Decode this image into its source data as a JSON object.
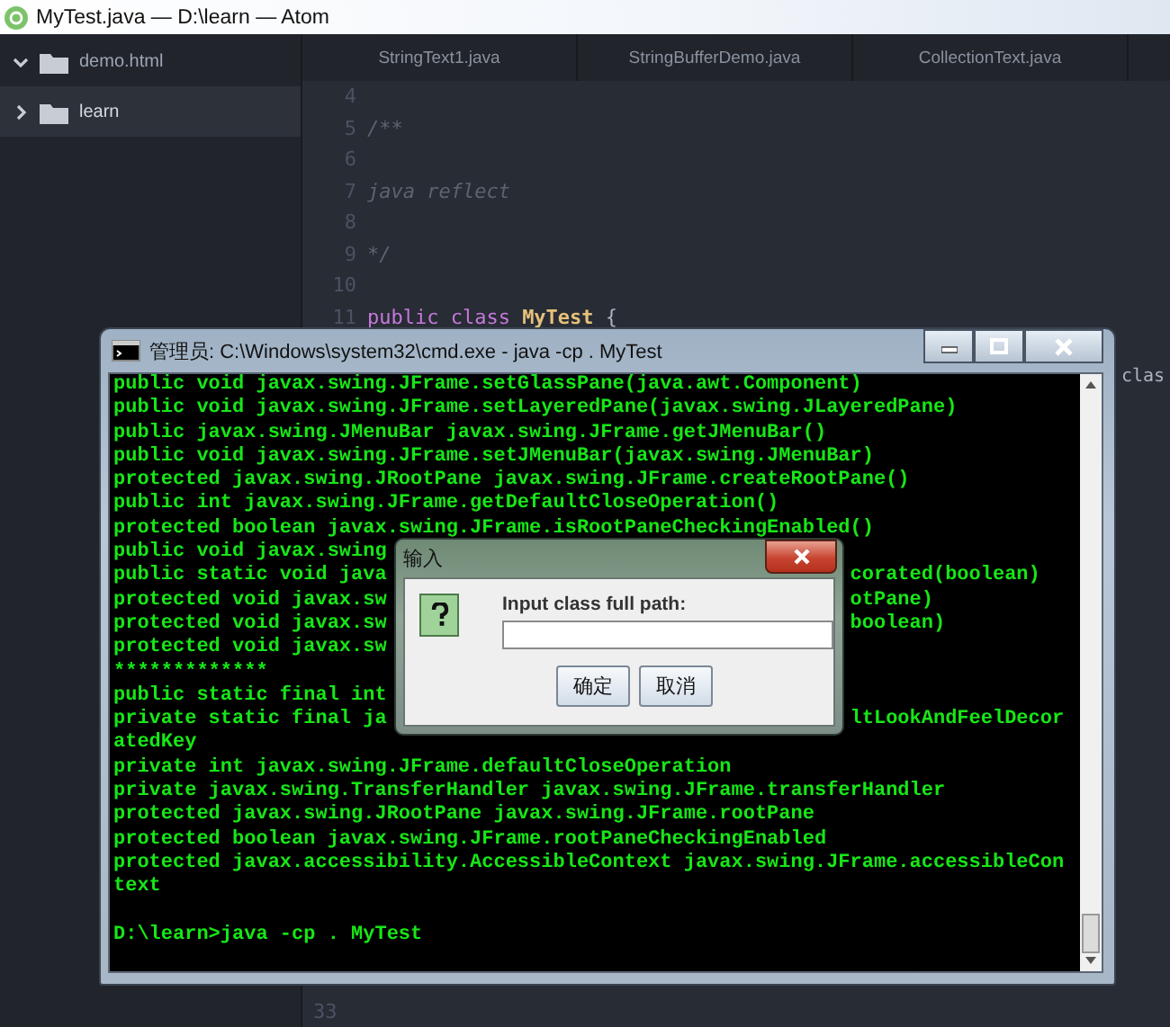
{
  "window": {
    "title": "MyTest.java — D:\\learn — Atom"
  },
  "tree": [
    {
      "label": "demo.html",
      "expanded": true,
      "selected": false
    },
    {
      "label": "learn",
      "expanded": false,
      "selected": true
    }
  ],
  "tabs": [
    {
      "label": "StringText1.java"
    },
    {
      "label": "StringBufferDemo.java"
    },
    {
      "label": "CollectionText.java"
    }
  ],
  "editor": {
    "lines": [
      {
        "number": "4"
      },
      {
        "number": "5",
        "tokens": [
          {
            "text": "/**",
            "kind": "comment"
          }
        ]
      },
      {
        "number": "6"
      },
      {
        "number": "7",
        "tokens": [
          {
            "text": "java reflect",
            "kind": "comment"
          }
        ]
      },
      {
        "number": "8"
      },
      {
        "number": "9",
        "tokens": [
          {
            "text": "*/",
            "kind": "comment"
          }
        ]
      },
      {
        "number": "10"
      },
      {
        "number": "11",
        "tokens": [
          {
            "text": "public",
            "kind": "keyword"
          },
          {
            "text": "class",
            "kind": "keyword"
          },
          {
            "text": "MyTest",
            "kind": "type"
          },
          {
            "text": "{",
            "kind": "plain"
          }
        ]
      }
    ],
    "peek_text": "clas",
    "bottom_line_number": "33"
  },
  "console": {
    "title": "管理员: C:\\Windows\\system32\\cmd.exe - java  -cp . MyTest",
    "lines": [
      {
        "kind": "text",
        "text": "public void javax.swing.JFrame.setGlassPane(java.awt.Component)"
      },
      {
        "kind": "text",
        "text": "public void javax.swing.JFrame.setLayeredPane(javax.swing.JLayeredPane)"
      },
      {
        "kind": "text",
        "text": "public javax.swing.JMenuBar javax.swing.JFrame.getJMenuBar()"
      },
      {
        "kind": "text",
        "text": "public void javax.swing.JFrame.setJMenuBar(javax.swing.JMenuBar)"
      },
      {
        "kind": "text",
        "text": "protected javax.swing.JRootPane javax.swing.JFrame.createRootPane()"
      },
      {
        "kind": "text",
        "text": "public int javax.swing.JFrame.getDefaultCloseOperation()"
      },
      {
        "kind": "text",
        "text": "protected boolean javax.swing.JFrame.isRootPaneCheckingEnabled()"
      },
      {
        "kind": "text",
        "text": "public void javax.swing"
      },
      {
        "kind": "split",
        "text": "public static void java",
        "right": "corated(boolean)"
      },
      {
        "kind": "split",
        "text": "protected void javax.sw",
        "right": "otPane)"
      },
      {
        "kind": "split",
        "text": "protected void javax.sw",
        "right": "boolean)"
      },
      {
        "kind": "text",
        "text": "protected void javax.sw"
      },
      {
        "kind": "text",
        "text": "*************"
      },
      {
        "kind": "text",
        "text": "public static final int"
      },
      {
        "kind": "split",
        "text": "private static final ja",
        "right": "ltLookAndFeelDecor"
      },
      {
        "kind": "text",
        "text": "atedKey"
      },
      {
        "kind": "text",
        "text": "private int javax.swing.JFrame.defaultCloseOperation"
      },
      {
        "kind": "text",
        "text": "private javax.swing.TransferHandler javax.swing.JFrame.transferHandler"
      },
      {
        "kind": "text",
        "text": "protected javax.swing.JRootPane javax.swing.JFrame.rootPane"
      },
      {
        "kind": "text",
        "text": "protected boolean javax.swing.JFrame.rootPaneCheckingEnabled"
      },
      {
        "kind": "text",
        "text": "protected javax.accessibility.AccessibleContext javax.swing.JFrame.accessibleCon"
      },
      {
        "kind": "text",
        "text": "text"
      },
      {
        "kind": "blank"
      },
      {
        "kind": "text",
        "text": "D:\\learn>java -cp . MyTest"
      }
    ]
  },
  "dialog": {
    "title": "输入",
    "prompt": "Input class full path:",
    "buttons": [
      "确定",
      "取消"
    ]
  }
}
